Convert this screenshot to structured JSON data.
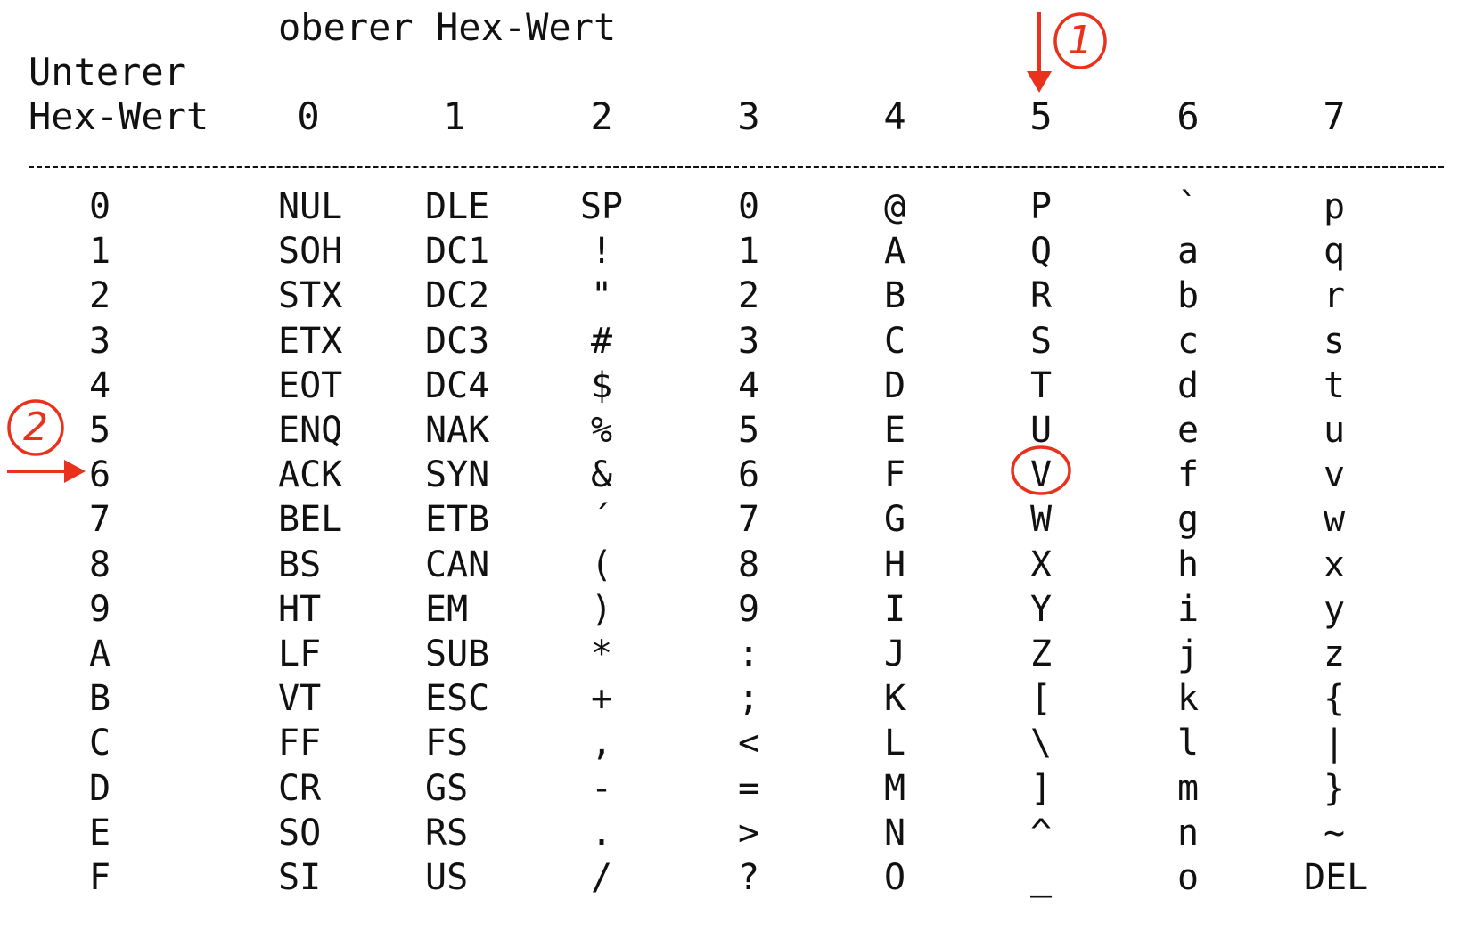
{
  "header": {
    "upper_title": "oberer Hex-Wert",
    "lower_title_line1": "Unterer",
    "lower_title_line2": "Hex-Wert"
  },
  "columns": [
    "0",
    "1",
    "2",
    "3",
    "4",
    "5",
    "6",
    "7"
  ],
  "rule": "--------------------------------------------------------------------------------",
  "rows": [
    {
      "label": "0",
      "cells": [
        "NUL",
        "DLE",
        "SP",
        "0",
        "@",
        "P",
        "`",
        "p"
      ]
    },
    {
      "label": "1",
      "cells": [
        "SOH",
        "DC1",
        "!",
        "1",
        "A",
        "Q",
        "a",
        "q"
      ]
    },
    {
      "label": "2",
      "cells": [
        "STX",
        "DC2",
        "\"",
        "2",
        "B",
        "R",
        "b",
        "r"
      ]
    },
    {
      "label": "3",
      "cells": [
        "ETX",
        "DC3",
        "#",
        "3",
        "C",
        "S",
        "c",
        "s"
      ]
    },
    {
      "label": "4",
      "cells": [
        "EOT",
        "DC4",
        "$",
        "4",
        "D",
        "T",
        "d",
        "t"
      ]
    },
    {
      "label": "5",
      "cells": [
        "ENQ",
        "NAK",
        "%",
        "5",
        "E",
        "U",
        "e",
        "u"
      ]
    },
    {
      "label": "6",
      "cells": [
        "ACK",
        "SYN",
        "&",
        "6",
        "F",
        "V",
        "f",
        "v"
      ]
    },
    {
      "label": "7",
      "cells": [
        "BEL",
        "ETB",
        "´",
        "7",
        "G",
        "W",
        "g",
        "w"
      ]
    },
    {
      "label": "8",
      "cells": [
        "BS",
        "CAN",
        "(",
        "8",
        "H",
        "X",
        "h",
        "x"
      ]
    },
    {
      "label": "9",
      "cells": [
        "HT",
        "EM",
        ")",
        "9",
        "I",
        "Y",
        "i",
        "y"
      ]
    },
    {
      "label": "A",
      "cells": [
        "LF",
        "SUB",
        "*",
        ":",
        "J",
        "Z",
        "j",
        "z"
      ]
    },
    {
      "label": "B",
      "cells": [
        "VT",
        "ESC",
        "+",
        ";",
        "K",
        "[",
        "k",
        "{"
      ]
    },
    {
      "label": "C",
      "cells": [
        "FF",
        "FS",
        ",",
        "<",
        "L",
        "\\",
        "l",
        "|"
      ]
    },
    {
      "label": "D",
      "cells": [
        "CR",
        "GS",
        "-",
        "=",
        "M",
        "]",
        "m",
        "}"
      ]
    },
    {
      "label": "E",
      "cells": [
        "SO",
        "RS",
        ".",
        ">",
        "N",
        "^",
        "n",
        "~"
      ]
    },
    {
      "label": "F",
      "cells": [
        "SI",
        "US",
        "/",
        "?",
        "O",
        "_",
        "o",
        "DEL"
      ]
    }
  ],
  "annotations": {
    "color": "#e8321e",
    "marker_1": "1",
    "marker_2": "2",
    "highlight_column": "5",
    "highlight_row": "6",
    "highlight_value": "V"
  }
}
